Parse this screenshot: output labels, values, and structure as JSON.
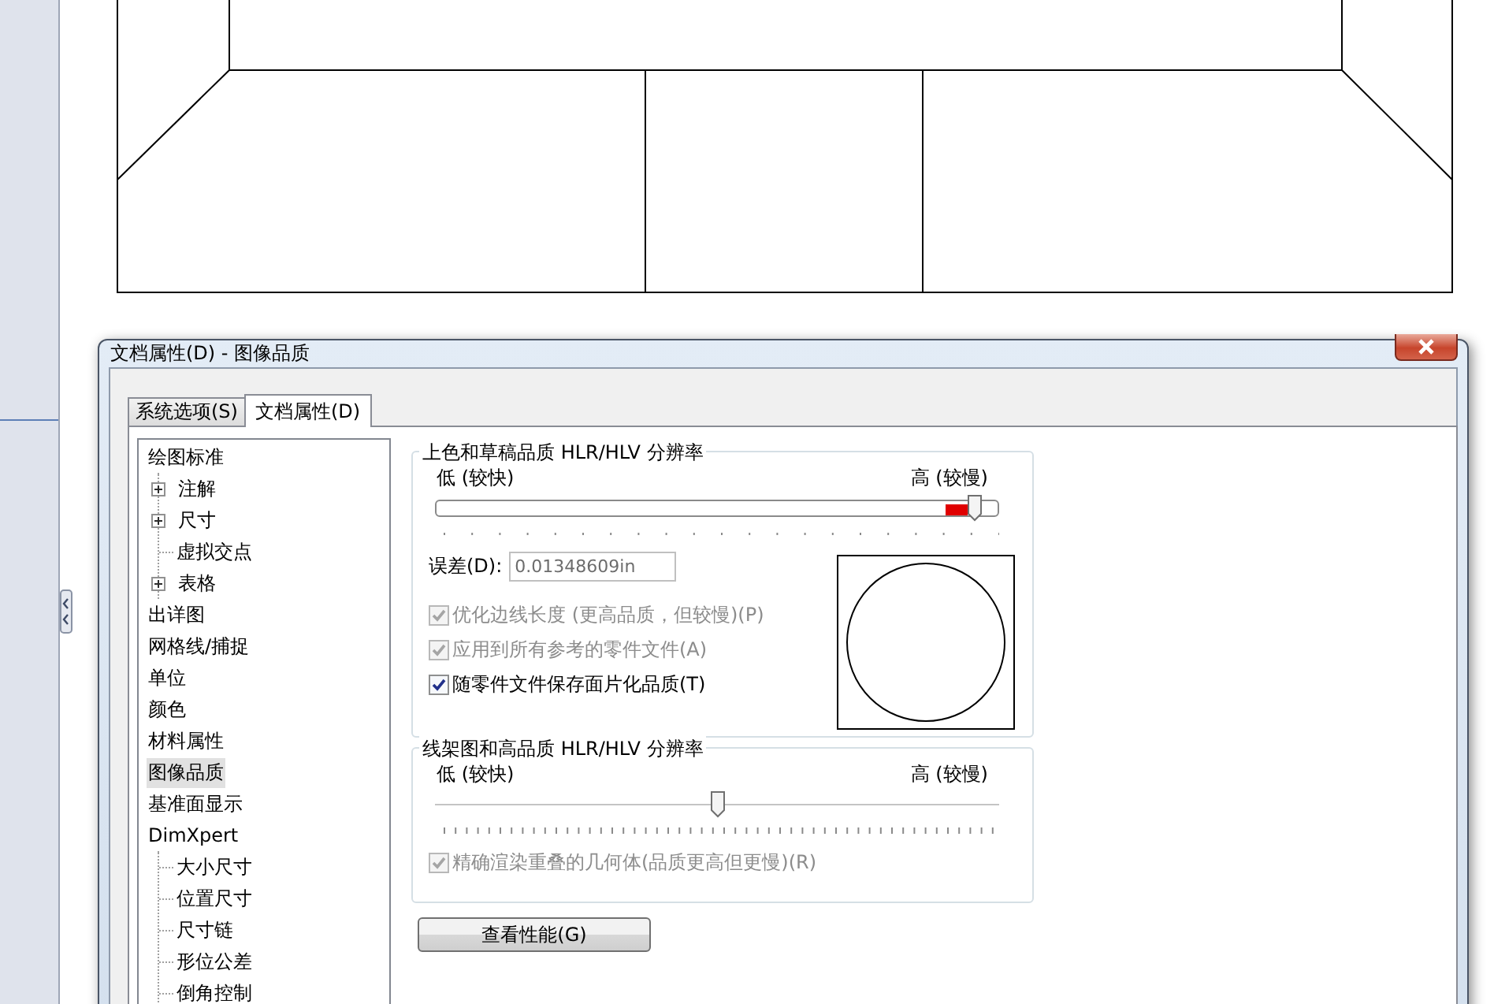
{
  "window": {
    "title": "文档属性(D) - 图像品质"
  },
  "tabs": [
    {
      "label": "系统选项(S)",
      "selected": false
    },
    {
      "label": "文档属性(D)",
      "selected": true
    }
  ],
  "tree": [
    {
      "label": "绘图标准",
      "selected": false,
      "children": [
        {
          "label": "注解",
          "selected": false,
          "expanded": false
        },
        {
          "label": "尺寸",
          "selected": false,
          "expanded": false
        },
        {
          "label": "虚拟交点",
          "selected": false
        },
        {
          "label": "表格",
          "selected": false,
          "expanded": false
        }
      ]
    },
    {
      "label": "出详图",
      "selected": false
    },
    {
      "label": "网格线/捕捉",
      "selected": false
    },
    {
      "label": "单位",
      "selected": false
    },
    {
      "label": "颜色",
      "selected": false
    },
    {
      "label": "材料属性",
      "selected": false
    },
    {
      "label": "图像品质",
      "selected": true
    },
    {
      "label": "基准面显示",
      "selected": false
    },
    {
      "label": "DimXpert",
      "selected": false,
      "children": [
        {
          "label": "大小尺寸",
          "selected": false
        },
        {
          "label": "位置尺寸",
          "selected": false
        },
        {
          "label": "尺寸链",
          "selected": false
        },
        {
          "label": "形位公差",
          "selected": false
        },
        {
          "label": "倒角控制",
          "selected": false
        }
      ]
    }
  ],
  "groups": [
    {
      "kind": "shaded",
      "title": "上色和草稿品质 HLR/HLV 分辨率",
      "low_label": "低 (较快)",
      "high_label": "高 (较慢)",
      "level": 0.97,
      "tolerance": {
        "label": "误差(D):",
        "value": "0.01348609in",
        "disabled": true
      },
      "checkboxes": [
        {
          "label": "优化边线长度 (更高品质，但较慢)(P)",
          "checked": true,
          "disabled": true
        },
        {
          "label": "应用到所有参考的零件文件(A)",
          "checked": true,
          "disabled": true
        },
        {
          "label": "随零件文件保存面片化品质(T)",
          "checked": true,
          "disabled": false
        }
      ]
    },
    {
      "kind": "wireframe",
      "title": "线架图和高品质 HLR/HLV 分辨率",
      "low_label": "低 (较快)",
      "high_label": "高 (较慢)",
      "level": 0.5,
      "checkboxes": [
        {
          "label": "精确渲染重叠的几何体(品质更高但更慢)(R)",
          "checked": true,
          "disabled": true
        }
      ]
    }
  ],
  "button": "查看性能(G)"
}
